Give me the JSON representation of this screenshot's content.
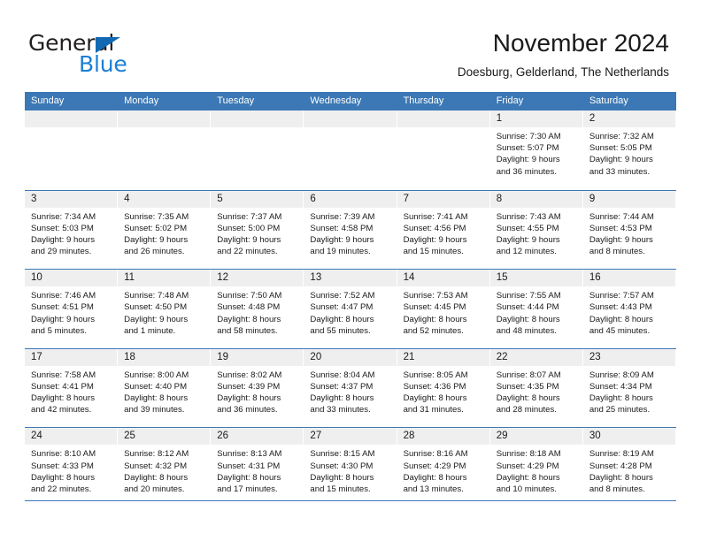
{
  "logo": {
    "primary_text": "General",
    "secondary_text": "Blue",
    "triangle_color": "#1268b3",
    "secondary_color": "#1c7fd4"
  },
  "header": {
    "title": "November 2024",
    "subtitle": "Doesburg, Gelderland, The Netherlands"
  },
  "theme": {
    "header_blue": "#3c78b5",
    "day_band_gray": "#efefef",
    "text": "#1a1a1a"
  },
  "weekdays": [
    "Sunday",
    "Monday",
    "Tuesday",
    "Wednesday",
    "Thursday",
    "Friday",
    "Saturday"
  ],
  "weeks": [
    [
      {
        "day": "",
        "lines": []
      },
      {
        "day": "",
        "lines": []
      },
      {
        "day": "",
        "lines": []
      },
      {
        "day": "",
        "lines": []
      },
      {
        "day": "",
        "lines": []
      },
      {
        "day": "1",
        "lines": [
          "Sunrise: 7:30 AM",
          "Sunset: 5:07 PM",
          "Daylight: 9 hours",
          "and 36 minutes."
        ]
      },
      {
        "day": "2",
        "lines": [
          "Sunrise: 7:32 AM",
          "Sunset: 5:05 PM",
          "Daylight: 9 hours",
          "and 33 minutes."
        ]
      }
    ],
    [
      {
        "day": "3",
        "lines": [
          "Sunrise: 7:34 AM",
          "Sunset: 5:03 PM",
          "Daylight: 9 hours",
          "and 29 minutes."
        ]
      },
      {
        "day": "4",
        "lines": [
          "Sunrise: 7:35 AM",
          "Sunset: 5:02 PM",
          "Daylight: 9 hours",
          "and 26 minutes."
        ]
      },
      {
        "day": "5",
        "lines": [
          "Sunrise: 7:37 AM",
          "Sunset: 5:00 PM",
          "Daylight: 9 hours",
          "and 22 minutes."
        ]
      },
      {
        "day": "6",
        "lines": [
          "Sunrise: 7:39 AM",
          "Sunset: 4:58 PM",
          "Daylight: 9 hours",
          "and 19 minutes."
        ]
      },
      {
        "day": "7",
        "lines": [
          "Sunrise: 7:41 AM",
          "Sunset: 4:56 PM",
          "Daylight: 9 hours",
          "and 15 minutes."
        ]
      },
      {
        "day": "8",
        "lines": [
          "Sunrise: 7:43 AM",
          "Sunset: 4:55 PM",
          "Daylight: 9 hours",
          "and 12 minutes."
        ]
      },
      {
        "day": "9",
        "lines": [
          "Sunrise: 7:44 AM",
          "Sunset: 4:53 PM",
          "Daylight: 9 hours",
          "and 8 minutes."
        ]
      }
    ],
    [
      {
        "day": "10",
        "lines": [
          "Sunrise: 7:46 AM",
          "Sunset: 4:51 PM",
          "Daylight: 9 hours",
          "and 5 minutes."
        ]
      },
      {
        "day": "11",
        "lines": [
          "Sunrise: 7:48 AM",
          "Sunset: 4:50 PM",
          "Daylight: 9 hours",
          "and 1 minute."
        ]
      },
      {
        "day": "12",
        "lines": [
          "Sunrise: 7:50 AM",
          "Sunset: 4:48 PM",
          "Daylight: 8 hours",
          "and 58 minutes."
        ]
      },
      {
        "day": "13",
        "lines": [
          "Sunrise: 7:52 AM",
          "Sunset: 4:47 PM",
          "Daylight: 8 hours",
          "and 55 minutes."
        ]
      },
      {
        "day": "14",
        "lines": [
          "Sunrise: 7:53 AM",
          "Sunset: 4:45 PM",
          "Daylight: 8 hours",
          "and 52 minutes."
        ]
      },
      {
        "day": "15",
        "lines": [
          "Sunrise: 7:55 AM",
          "Sunset: 4:44 PM",
          "Daylight: 8 hours",
          "and 48 minutes."
        ]
      },
      {
        "day": "16",
        "lines": [
          "Sunrise: 7:57 AM",
          "Sunset: 4:43 PM",
          "Daylight: 8 hours",
          "and 45 minutes."
        ]
      }
    ],
    [
      {
        "day": "17",
        "lines": [
          "Sunrise: 7:58 AM",
          "Sunset: 4:41 PM",
          "Daylight: 8 hours",
          "and 42 minutes."
        ]
      },
      {
        "day": "18",
        "lines": [
          "Sunrise: 8:00 AM",
          "Sunset: 4:40 PM",
          "Daylight: 8 hours",
          "and 39 minutes."
        ]
      },
      {
        "day": "19",
        "lines": [
          "Sunrise: 8:02 AM",
          "Sunset: 4:39 PM",
          "Daylight: 8 hours",
          "and 36 minutes."
        ]
      },
      {
        "day": "20",
        "lines": [
          "Sunrise: 8:04 AM",
          "Sunset: 4:37 PM",
          "Daylight: 8 hours",
          "and 33 minutes."
        ]
      },
      {
        "day": "21",
        "lines": [
          "Sunrise: 8:05 AM",
          "Sunset: 4:36 PM",
          "Daylight: 8 hours",
          "and 31 minutes."
        ]
      },
      {
        "day": "22",
        "lines": [
          "Sunrise: 8:07 AM",
          "Sunset: 4:35 PM",
          "Daylight: 8 hours",
          "and 28 minutes."
        ]
      },
      {
        "day": "23",
        "lines": [
          "Sunrise: 8:09 AM",
          "Sunset: 4:34 PM",
          "Daylight: 8 hours",
          "and 25 minutes."
        ]
      }
    ],
    [
      {
        "day": "24",
        "lines": [
          "Sunrise: 8:10 AM",
          "Sunset: 4:33 PM",
          "Daylight: 8 hours",
          "and 22 minutes."
        ]
      },
      {
        "day": "25",
        "lines": [
          "Sunrise: 8:12 AM",
          "Sunset: 4:32 PM",
          "Daylight: 8 hours",
          "and 20 minutes."
        ]
      },
      {
        "day": "26",
        "lines": [
          "Sunrise: 8:13 AM",
          "Sunset: 4:31 PM",
          "Daylight: 8 hours",
          "and 17 minutes."
        ]
      },
      {
        "day": "27",
        "lines": [
          "Sunrise: 8:15 AM",
          "Sunset: 4:30 PM",
          "Daylight: 8 hours",
          "and 15 minutes."
        ]
      },
      {
        "day": "28",
        "lines": [
          "Sunrise: 8:16 AM",
          "Sunset: 4:29 PM",
          "Daylight: 8 hours",
          "and 13 minutes."
        ]
      },
      {
        "day": "29",
        "lines": [
          "Sunrise: 8:18 AM",
          "Sunset: 4:29 PM",
          "Daylight: 8 hours",
          "and 10 minutes."
        ]
      },
      {
        "day": "30",
        "lines": [
          "Sunrise: 8:19 AM",
          "Sunset: 4:28 PM",
          "Daylight: 8 hours",
          "and 8 minutes."
        ]
      }
    ]
  ]
}
